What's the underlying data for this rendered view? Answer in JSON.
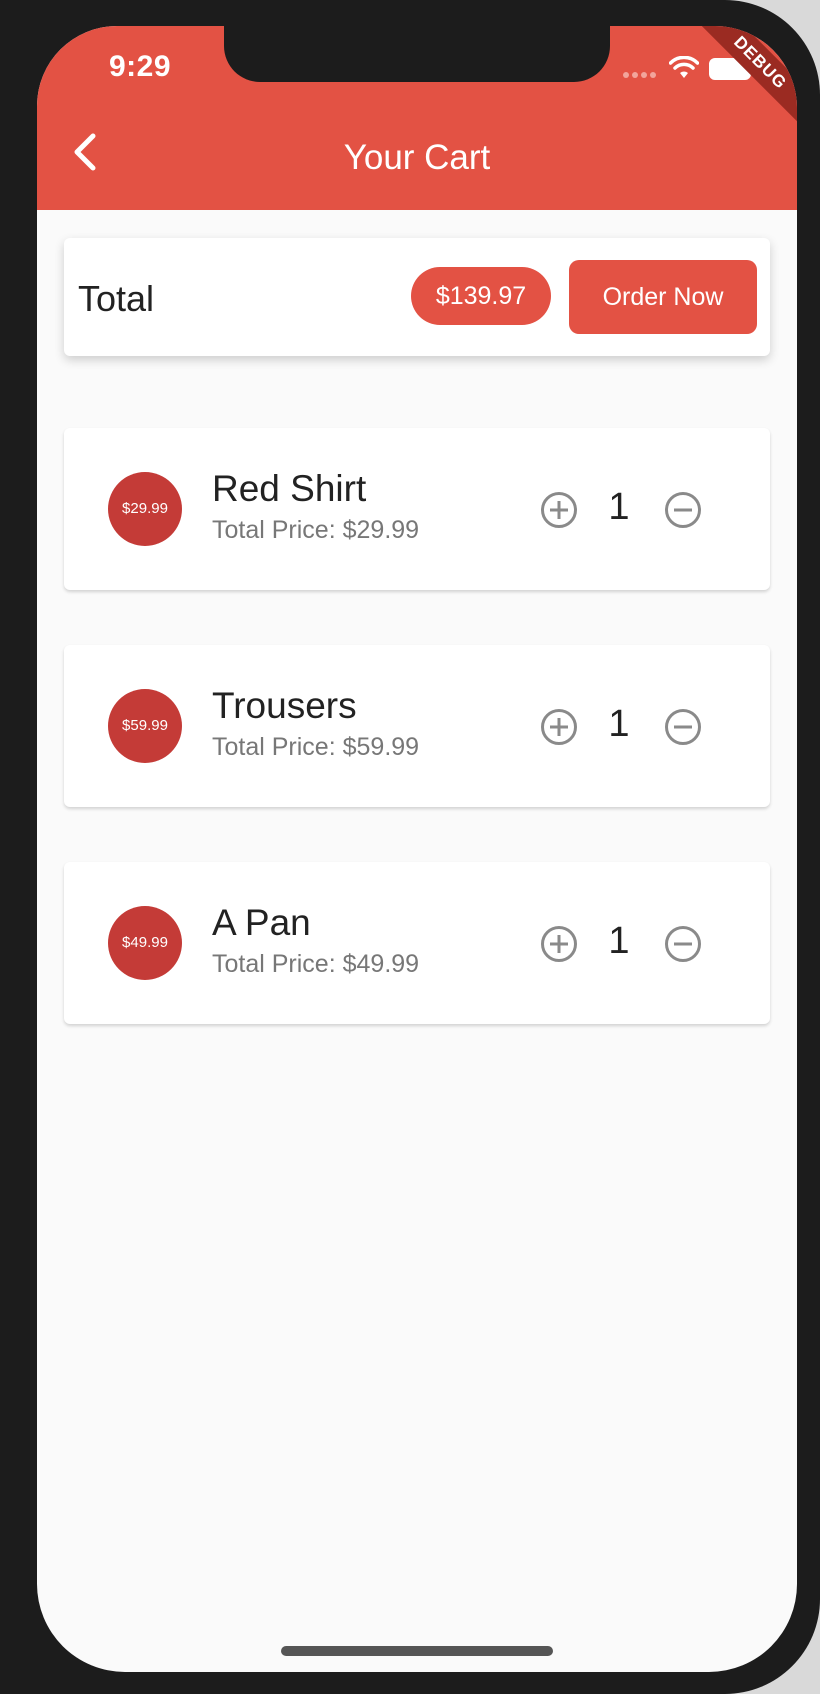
{
  "status_bar": {
    "time": "9:29",
    "debug_label": "DEBUG"
  },
  "appbar": {
    "title": "Your Cart",
    "back_icon": "chevron-left-icon",
    "color": "#e35244"
  },
  "summary": {
    "total_label": "Total",
    "total_amount": "$139.97",
    "order_button_label": "Order Now"
  },
  "items": [
    {
      "avatar_price": "$29.99",
      "name": "Red Shirt",
      "subtitle": "Total Price: $29.99",
      "quantity": "1"
    },
    {
      "avatar_price": "$59.99",
      "name": "Trousers",
      "subtitle": "Total Price: $59.99",
      "quantity": "1"
    },
    {
      "avatar_price": "$49.99",
      "name": "A Pan",
      "subtitle": "Total Price: $49.99",
      "quantity": "1"
    }
  ],
  "colors": {
    "accent": "#e35244",
    "avatar": "#c43b37",
    "background": "#fafafa"
  },
  "icons": {
    "plus": "add-circle-outline-icon",
    "minus": "remove-circle-outline-icon"
  }
}
